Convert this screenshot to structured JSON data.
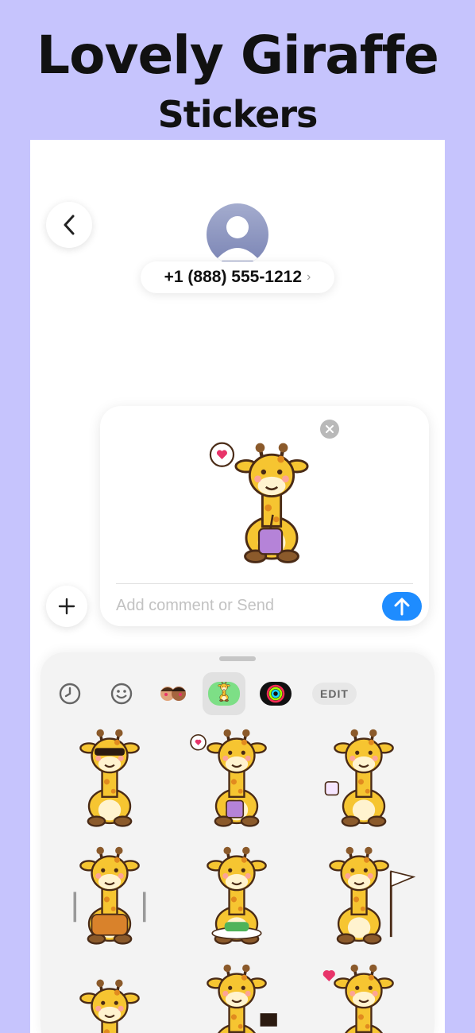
{
  "promo": {
    "title_line1": "Lovely Giraffe",
    "title_line2": "Stickers"
  },
  "header": {
    "phone_number": "+1 (888) 555-1212",
    "chevron": "›"
  },
  "compose": {
    "placeholder": "Add comment or Send"
  },
  "drawer": {
    "edit_label": "EDIT"
  },
  "colors": {
    "background": "#c6c4fd",
    "send_blue": "#1e8cff",
    "giraffe_yellow": "#f6c531",
    "giraffe_spot": "#e18a1f"
  },
  "icons": [
    "chevron-left-icon",
    "person-icon",
    "close-icon",
    "arrow-up-icon",
    "plus-icon",
    "clock-icon",
    "smiley-icon",
    "memoji-icon",
    "giraffe-app-icon",
    "activity-rings-icon"
  ]
}
